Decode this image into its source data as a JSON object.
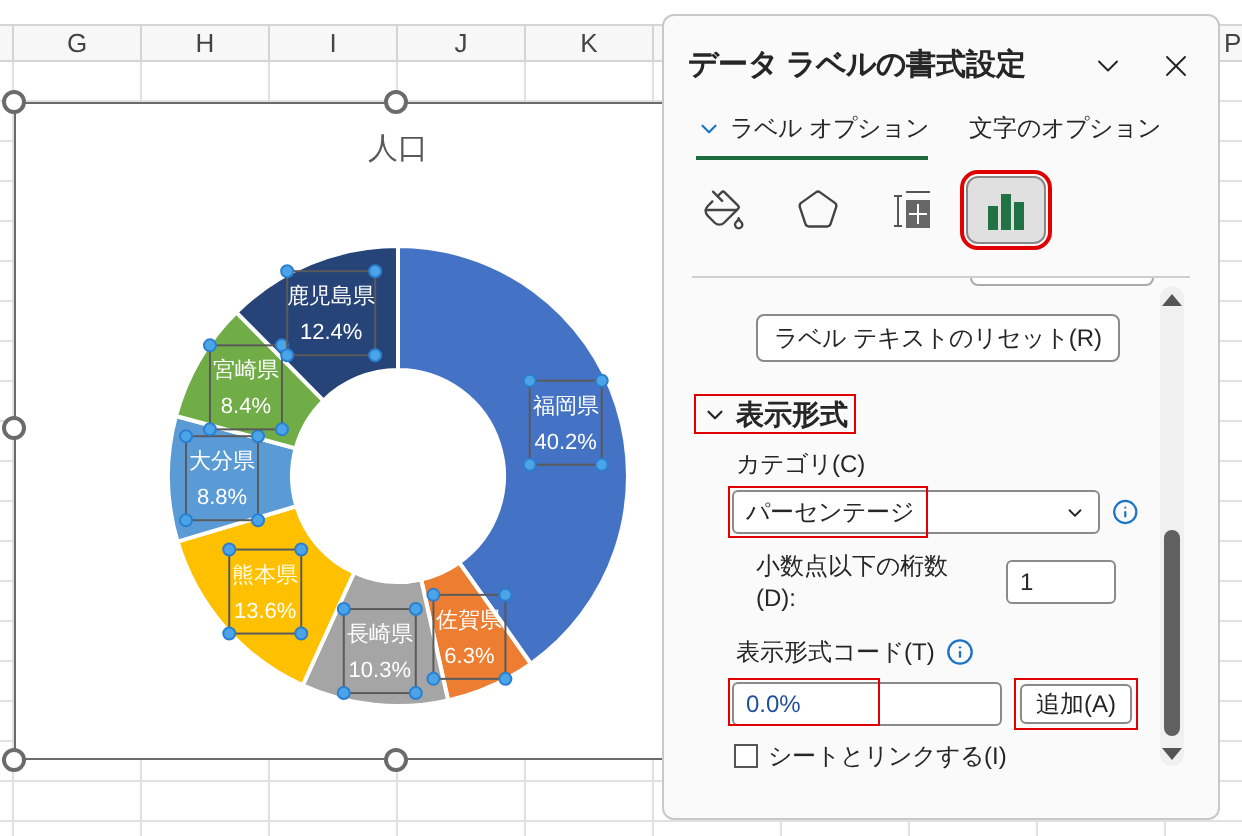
{
  "sheet": {
    "columns": [
      "G",
      "H",
      "I",
      "J",
      "K",
      "P"
    ]
  },
  "chart": {
    "chart_data": {
      "type": "donut",
      "title": "人口",
      "categories": [
        "福岡県",
        "佐賀県",
        "長崎県",
        "熊本県",
        "大分県",
        "宮崎県",
        "鹿児島県"
      ],
      "values": [
        40.2,
        6.3,
        10.3,
        13.6,
        8.8,
        8.4,
        12.4
      ],
      "colors": [
        "#4472c4",
        "#ed7d31",
        "#a5a5a5",
        "#ffc000",
        "#5b9bd5",
        "#70ad47",
        "#264478"
      ],
      "data_labels": true,
      "value_labels": [
        "40.2%",
        "6.3%",
        "10.3%",
        "13.6%",
        "8.8%",
        "8.4%",
        "12.4%"
      ]
    }
  },
  "panel": {
    "title": "データ ラベルの書式設定",
    "tabs": [
      {
        "label": "ラベル オプション",
        "selected": true
      },
      {
        "label": "文字のオプション",
        "selected": false
      }
    ],
    "icon_tabs": [
      {
        "kind": "fill",
        "selected": false
      },
      {
        "kind": "effects",
        "selected": false
      },
      {
        "kind": "size",
        "selected": false
      },
      {
        "kind": "options",
        "selected": true
      }
    ],
    "reset_button": "ラベル テキストのリセット(R)",
    "section": {
      "title": "表示形式",
      "expanded": true
    },
    "category": {
      "label": "カテゴリ(C)",
      "value": "パーセンテージ"
    },
    "decimal": {
      "label": "小数点以下の桁数(D):",
      "value": "1"
    },
    "format_code": {
      "label": "表示形式コード(T)",
      "value": "0.0%"
    },
    "add_button": "追加(A)",
    "link_checkbox": {
      "label": "シートとリンクする(I)",
      "checked": false
    }
  }
}
